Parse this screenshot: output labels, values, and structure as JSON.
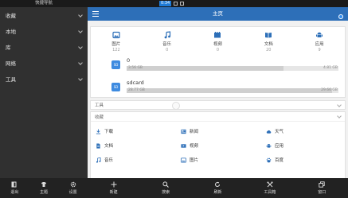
{
  "statusbar": {
    "left_title": "快捷导航",
    "time": "0:34"
  },
  "drawer": {
    "items": [
      {
        "label": "收藏"
      },
      {
        "label": "本地"
      },
      {
        "label": "库"
      },
      {
        "label": "网络"
      },
      {
        "label": "工具"
      }
    ],
    "bottom": [
      {
        "label": "退出",
        "icon": "exit-icon"
      },
      {
        "label": "主题",
        "icon": "theme-icon"
      },
      {
        "label": "设置",
        "icon": "gear-icon"
      }
    ]
  },
  "header": {
    "title": "主页"
  },
  "categories": [
    {
      "label": "图片",
      "count": "122",
      "icon": "image-icon",
      "color": "#2d6fb8"
    },
    {
      "label": "音乐",
      "count": "0",
      "icon": "music-icon",
      "color": "#2d6fb8"
    },
    {
      "label": "视频",
      "count": "0",
      "icon": "video-icon",
      "color": "#2d6fb8"
    },
    {
      "label": "文档",
      "count": "20",
      "icon": "book-icon",
      "color": "#2d6fb8"
    },
    {
      "label": "应用",
      "count": "9",
      "icon": "android-icon",
      "color": "#2d6fb8"
    }
  ],
  "storage": [
    {
      "name": "0",
      "used": "3.56 GB",
      "total": "4.81 GB",
      "fraction": 0.74
    },
    {
      "name": "sdcard",
      "used": "28.77 GB",
      "total": "29.66 GB",
      "fraction": 0.97
    }
  ],
  "tools": {
    "header": "工具"
  },
  "favorites": {
    "header": "收藏",
    "items": [
      {
        "label": "下载",
        "icon": "download-icon"
      },
      {
        "label": "新闻",
        "icon": "news-icon"
      },
      {
        "label": "天气",
        "icon": "weather-icon"
      },
      {
        "label": "文档",
        "icon": "document-icon"
      },
      {
        "label": "视频",
        "icon": "video-icon"
      },
      {
        "label": "应用",
        "icon": "android-icon"
      },
      {
        "label": "音乐",
        "icon": "music-icon"
      },
      {
        "label": "图片",
        "icon": "image-icon"
      },
      {
        "label": "百度",
        "icon": "baidu-icon"
      }
    ]
  },
  "bottombar": [
    {
      "label": "新建",
      "icon": "plus-icon"
    },
    {
      "label": "搜索",
      "icon": "search-icon"
    },
    {
      "label": "刷新",
      "icon": "refresh-icon"
    },
    {
      "label": "工具箱",
      "icon": "toolbox-icon"
    },
    {
      "label": "窗口",
      "icon": "window-icon"
    }
  ],
  "colors": {
    "accent": "#2d6fb8",
    "drawer_bg": "#303030",
    "bottombar_bg": "#222222"
  }
}
